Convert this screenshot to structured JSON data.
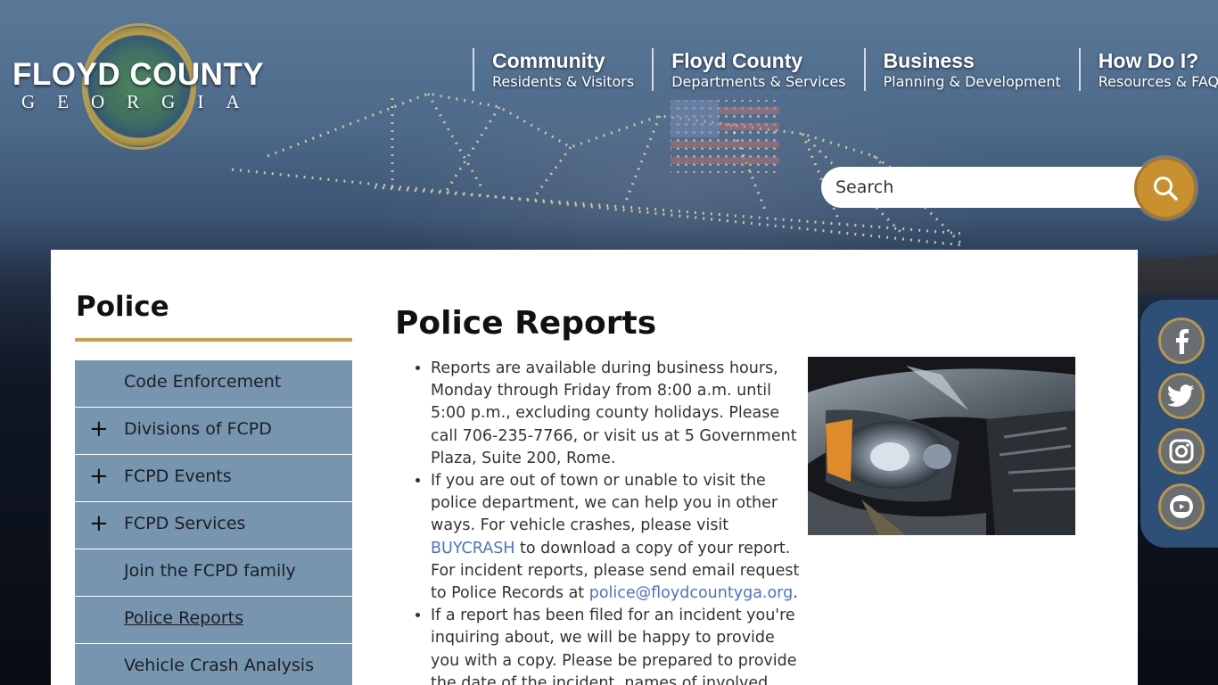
{
  "logo": {
    "title": "FLOYD COUNTY",
    "subtitle": "GEORGIA"
  },
  "nav": [
    {
      "title": "Community",
      "sub": "Residents & Visitors"
    },
    {
      "title": "Floyd County",
      "sub": "Departments & Services"
    },
    {
      "title": "Business",
      "sub": "Planning & Development"
    },
    {
      "title": "How Do I?",
      "sub": "Resources & FAQs"
    }
  ],
  "search": {
    "placeholder": "Search"
  },
  "social": [
    "facebook-icon",
    "twitter-icon",
    "instagram-icon",
    "youtube-icon"
  ],
  "sidebar": {
    "title": "Police",
    "items": [
      {
        "label": "Code Enforcement",
        "expandable": false
      },
      {
        "label": "Divisions of FCPD",
        "expandable": true,
        "toggle": "+"
      },
      {
        "label": "FCPD Events",
        "expandable": true,
        "toggle": "+"
      },
      {
        "label": "FCPD Services",
        "expandable": true,
        "toggle": "+"
      },
      {
        "label": "Join the FCPD family",
        "expandable": false
      },
      {
        "label": "Police Reports",
        "expandable": false,
        "active": true
      },
      {
        "label": "Vehicle Crash Analysis",
        "expandable": false
      }
    ]
  },
  "main": {
    "title": "Police Reports",
    "p1": "Reports are available during business hours, Monday through Friday from 8:00 a.m. until 5:00 p.m., excluding county holidays. Please call 706-235-7766, or visit us at 5 Government Plaza, Suite 200, Rome.",
    "p2_before": "If you are out of town or unable to visit the police department, we can help you in other ways. For vehicle crashes, please visit ",
    "p2_link": "BUYCRASH",
    "p2_mid": " to download a copy of your report. For incident reports, please send email request to Police Records at ",
    "p2_email": "police@floydcountyga.org",
    "p2_after": ".",
    "p3": "If a report has been filed for an incident you're inquiring about, we will be happy to provide you with a copy. Please be prepared to provide the date of the incident, names of involved parties"
  },
  "colors": {
    "accent": "#c8902e",
    "sidebar": "#7795ae",
    "link": "#4a73c6",
    "social_bg": "#2e4f78"
  }
}
